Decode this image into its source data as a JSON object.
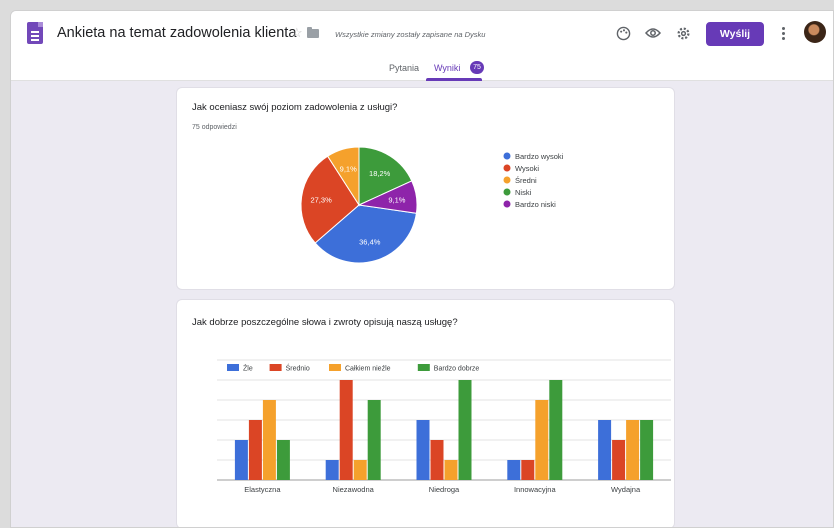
{
  "header": {
    "title": "Ankieta na temat zadowolenia klienta",
    "saved_status": "Wszystkie zmiany zostały zapisane na Dysku",
    "send_label": "Wyślij"
  },
  "tabs": [
    {
      "label": "Pytania"
    },
    {
      "label": "Wyniki",
      "badge": "75"
    }
  ],
  "colors": {
    "accent": "#673ab7",
    "blue": "#3d6fd9",
    "red": "#db4525",
    "orange": "#f5a12c",
    "green": "#3d9b3b",
    "purple": "#8e24aa"
  },
  "question1": {
    "title": "Jak oceniasz swój poziom zadowolenia z usługi?",
    "responses": "75 odpowiedzi"
  },
  "question2": {
    "title": "Jak dobrze poszczególne słowa i zwroty opisują naszą usługę?"
  },
  "chart_data": [
    {
      "type": "pie",
      "labels": [
        "Bardzo wysoki",
        "Wysoki",
        "Średni",
        "Niski",
        "Bardzo niski"
      ],
      "values": [
        36.4,
        27.3,
        9.1,
        18.2,
        9.1
      ],
      "value_labels": [
        "36,4%",
        "27,3%",
        "9,1%",
        "18,2%",
        "9,1%"
      ],
      "colors": [
        "#3d6fd9",
        "#db4525",
        "#f5a12c",
        "#3d9b3b",
        "#8e24aa"
      ],
      "legend": "right"
    },
    {
      "type": "bar",
      "categories": [
        "Elastyczna",
        "Niezawodna",
        "Niedroga",
        "Innowacyjna",
        "Wydajna"
      ],
      "series": [
        {
          "name": "Źle",
          "color": "#3d6fd9",
          "values": [
            2,
            1,
            3,
            1,
            3
          ]
        },
        {
          "name": "Średnio",
          "color": "#db4525",
          "values": [
            3,
            5,
            2,
            1,
            2
          ]
        },
        {
          "name": "Całkiem nieźle",
          "color": "#f5a12c",
          "values": [
            4,
            1,
            1,
            4,
            3
          ]
        },
        {
          "name": "Bardzo dobrze",
          "color": "#3d9b3b",
          "values": [
            2,
            4,
            5,
            5,
            3
          ]
        }
      ],
      "ylim": [
        0,
        6
      ],
      "grid": true,
      "legend": "top-left"
    }
  ]
}
